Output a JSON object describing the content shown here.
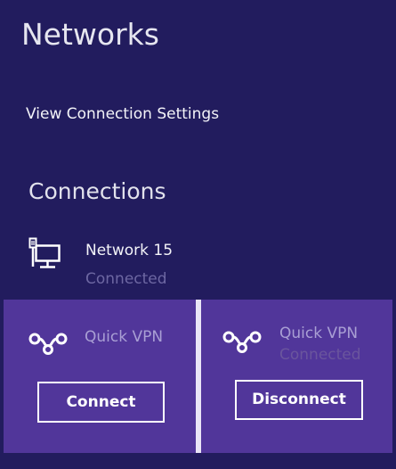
{
  "panel": {
    "title": "Networks",
    "view_settings_link": "View Connection Settings"
  },
  "connections": {
    "heading": "Connections",
    "network": {
      "name": "Network  15",
      "status": "Connected",
      "icon": "wired-monitor-icon"
    }
  },
  "vpn": [
    {
      "name": "Quick VPN",
      "status": "",
      "button_label": "Connect",
      "icon": "vpn-link-icon"
    },
    {
      "name": "Quick VPN",
      "status": "Connected",
      "button_label": "Disconnect",
      "icon": "vpn-link-icon"
    }
  ],
  "colors": {
    "panel_background": "#221c5e",
    "vpn_tile_background": "#51369a",
    "divider": "#e9e5f6",
    "primary_text": "#f3f3f8",
    "muted_text": "#6d67a2"
  }
}
